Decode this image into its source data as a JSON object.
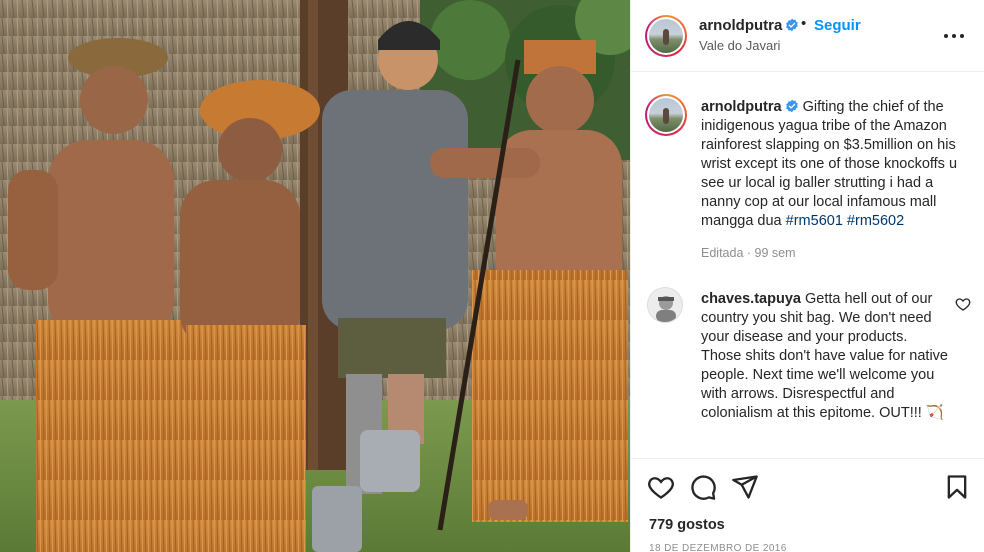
{
  "post": {
    "username": "arnoldputra",
    "follow_label": "Seguir",
    "location": "Vale do Javari",
    "caption_username": "arnoldputra",
    "caption_text": "Gifting the chief of the inidigenous yagua tribe of the Amazon rainforest slapping on $3.5million on his wrist except its one of those knockoffs u see ur local ig baller strutting i had a nanny cop at our local infamous mall mangga dua",
    "hashtags": [
      "#rm5601",
      "#rm5602"
    ],
    "edited_label": "Editada",
    "age": "99 sem",
    "likes_label": "779 gostos",
    "date": "18 de dezembro de 2016"
  },
  "comment": {
    "username": "chaves.tapuya",
    "text": "Getta hell out of our country you shit bag. We don't need your disease and your products. Those shits don't have value for native people. Next time we'll welcome you with arrows. Disrespectful and colonialism at this epitome. OUT!!!",
    "emoji": "🏹"
  },
  "icons": {
    "verified": "verified-badge-icon",
    "more": "more-options-icon",
    "like": "heart-icon",
    "comment": "comment-icon",
    "share": "share-icon",
    "save": "bookmark-icon",
    "comment_like": "heart-small-icon"
  },
  "colors": {
    "accent": "#0095f6",
    "verified": "#3897f0",
    "hashtag": "#00376b",
    "muted": "#8e8e8e"
  }
}
